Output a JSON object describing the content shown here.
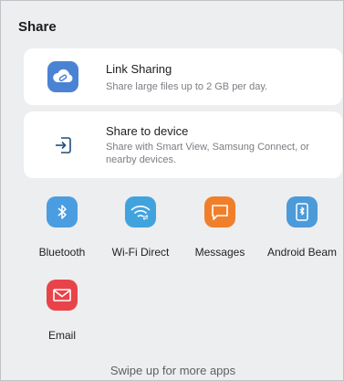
{
  "panel": {
    "title": "Share"
  },
  "cards": [
    {
      "title": "Link Sharing",
      "subtitle": "Share large files up to 2 GB per day.",
      "icon": "cloud-link-icon",
      "color": "#4b83d4"
    },
    {
      "title": "Share to device",
      "subtitle": "Share with Smart View, Samsung Connect, or nearby devices.",
      "icon": "share-to-device-icon",
      "color": "#1e4f7a"
    }
  ],
  "apps": [
    {
      "label": "Bluetooth",
      "icon": "bluetooth-icon",
      "color": "#4a9de0"
    },
    {
      "label": "Wi-Fi Direct",
      "icon": "wifi-direct-icon",
      "color": "#41a3de"
    },
    {
      "label": "Messages",
      "icon": "messages-icon",
      "color": "#f07f2b"
    },
    {
      "label": "Android Beam",
      "icon": "android-beam-icon",
      "color": "#4b9ad9"
    },
    {
      "label": "Email",
      "icon": "email-icon",
      "color": "#e9434a"
    }
  ],
  "footer": {
    "hint": "Swipe up for more apps"
  }
}
